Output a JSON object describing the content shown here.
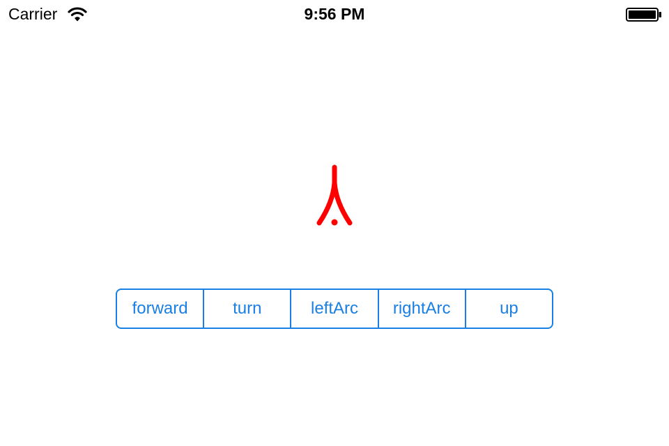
{
  "status_bar": {
    "carrier": "Carrier",
    "time": "9:56 PM",
    "wifi_icon": "wifi-icon",
    "battery_icon": "battery-full-icon"
  },
  "drawing": {
    "stroke_color": "#ff0000",
    "shape": "turtle-path"
  },
  "controls": {
    "accent_color": "#1a7fe4",
    "segments": [
      {
        "label": "forward"
      },
      {
        "label": "turn"
      },
      {
        "label": "leftArc"
      },
      {
        "label": "rightArc"
      },
      {
        "label": "up"
      }
    ]
  }
}
